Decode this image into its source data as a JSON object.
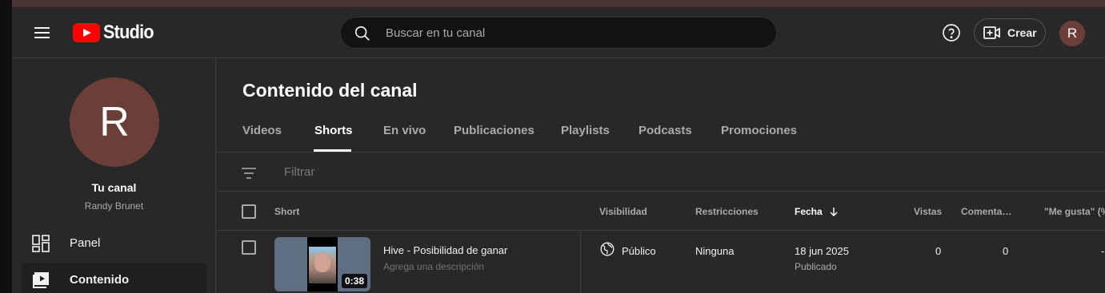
{
  "header": {
    "logo_text": "Studio",
    "search_placeholder": "Buscar en tu canal",
    "create_label": "Crear",
    "avatar_letter": "R"
  },
  "sidebar": {
    "avatar_letter": "R",
    "channel_title": "Tu canal",
    "channel_name": "Randy Brunet",
    "items": [
      {
        "label": "Panel",
        "icon": "dashboard-icon",
        "active": false
      },
      {
        "label": "Contenido",
        "icon": "content-icon",
        "active": true
      }
    ]
  },
  "main": {
    "title": "Contenido del canal",
    "tabs": [
      {
        "label": "Videos",
        "active": false
      },
      {
        "label": "Shorts",
        "active": true
      },
      {
        "label": "En vivo",
        "active": false
      },
      {
        "label": "Publicaciones",
        "active": false
      },
      {
        "label": "Playlists",
        "active": false
      },
      {
        "label": "Podcasts",
        "active": false
      },
      {
        "label": "Promociones",
        "active": false
      }
    ],
    "filter_placeholder": "Filtrar",
    "columns": {
      "short": "Short",
      "visibility": "Visibilidad",
      "restrictions": "Restricciones",
      "date": "Fecha",
      "views": "Vistas",
      "comments": "Comenta…",
      "likes": "\"Me gusta\" (%"
    },
    "rows": [
      {
        "duration": "0:38",
        "title": "Hive - Posibilidad de ganar",
        "description": "Agrega una descripción",
        "visibility": "Público",
        "restrictions": "Ninguna",
        "date": "18 jun 2025",
        "date_status": "Publicado",
        "views": "0",
        "comments": "0",
        "likes": "-"
      }
    ]
  }
}
